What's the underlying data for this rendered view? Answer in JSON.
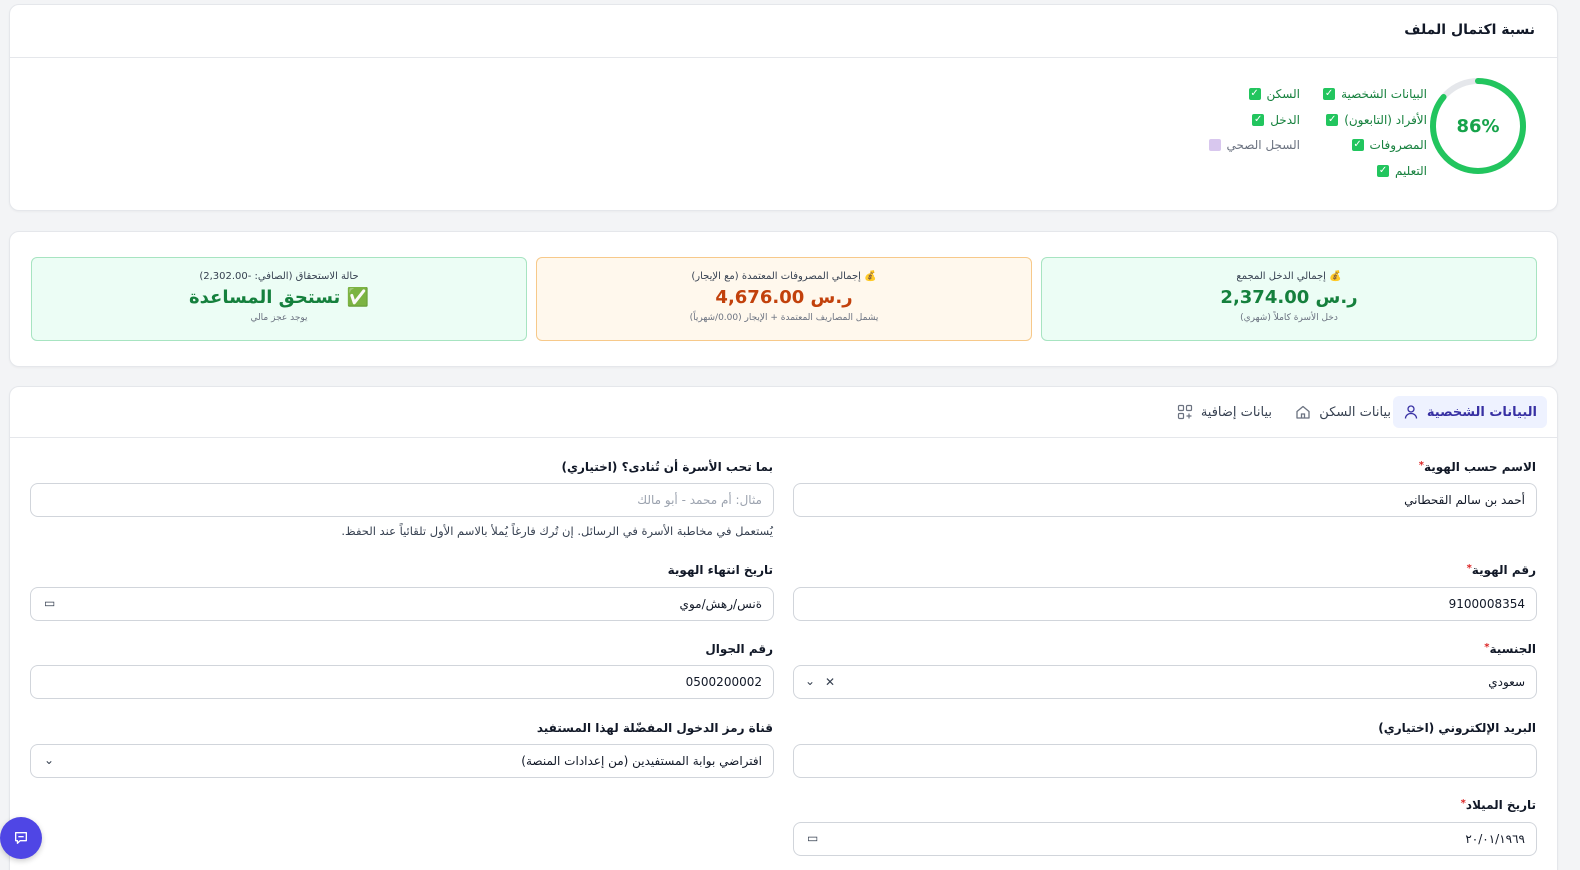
{
  "completion": {
    "title": "نسبة اكتمال الملف",
    "percent_label": "86%",
    "percent": 86,
    "items": [
      {
        "label": "البيانات الشخصية",
        "done": true
      },
      {
        "label": "الأفراد (التابعون)",
        "done": true
      },
      {
        "label": "المصروفات",
        "done": true
      },
      {
        "label": "التعليم",
        "done": true
      },
      {
        "label": "السكن",
        "done": true
      },
      {
        "label": "الدخل",
        "done": true
      },
      {
        "label": "السجل الصحي",
        "done": false
      }
    ]
  },
  "summary": {
    "income": {
      "title": "💰 إجمالي الدخل المجمع",
      "value": "ر.س 2,374.00",
      "sub": "دخل الأسرة كاملاً (شهري)"
    },
    "expenses": {
      "title": "💰 إجمالي المصروفات المعتمدة (مع الإيجار)",
      "value": "ر.س 4,676.00",
      "sub": "يشمل المصاريف المعتمدة + الإيجار (0.00/شهرياً)"
    },
    "eligibility": {
      "title": "حالة الاستحقاق (الصافي: -2,302.00)",
      "value": "✅ تستحق المساعدة",
      "sub": "يوجد عجز مالي"
    }
  },
  "tabs": [
    {
      "label": "البيانات الشخصية",
      "icon": "user-icon",
      "active": true
    },
    {
      "label": "بيانات السكن",
      "icon": "home-icon",
      "active": false
    },
    {
      "label": "بيانات إضافية",
      "icon": "grid-plus-icon",
      "active": false
    }
  ],
  "form": {
    "full_name": {
      "label": "الاسم حسب الهوية",
      "value": "أحمد بن سالم القحطاني",
      "required": true
    },
    "nickname": {
      "label": "بما تحب الأسرة أن تُنادى؟ (اختياري)",
      "placeholder": "مثال: أم محمد - أبو مالك",
      "help": "يُستعمل في مخاطبة الأسرة في الرسائل. إن تُرك فارغاً يُملأ بالاسم الأول تلقائياً عند الحفظ."
    },
    "id_number": {
      "label": "رقم الهوية",
      "value": "9100008354",
      "required": true
    },
    "id_expiry": {
      "label": "تاريخ انتهاء الهوية",
      "value": "ةنس/رهش/موي"
    },
    "nationality": {
      "label": "الجنسية",
      "value": "سعودي",
      "required": true
    },
    "mobile": {
      "label": "رقم الجوال",
      "value": "0500200002"
    },
    "email": {
      "label": "البريد الإلكتروني (اختياري)",
      "value": ""
    },
    "login_channel": {
      "label": "قناة رمز الدخول المفضّلة لهذا المستفيد",
      "value": "افتراضي بوابة المستفيدين (من إعدادات المنصة)"
    },
    "birth_date": {
      "label": "تاريخ الميلاد",
      "value": "٢٠/٠١/١٩٦٩",
      "required": true
    }
  },
  "colors": {
    "accent": "#4f46e5",
    "success": "#16a34a",
    "warning": "#c2410c",
    "required": "#dc2626"
  }
}
